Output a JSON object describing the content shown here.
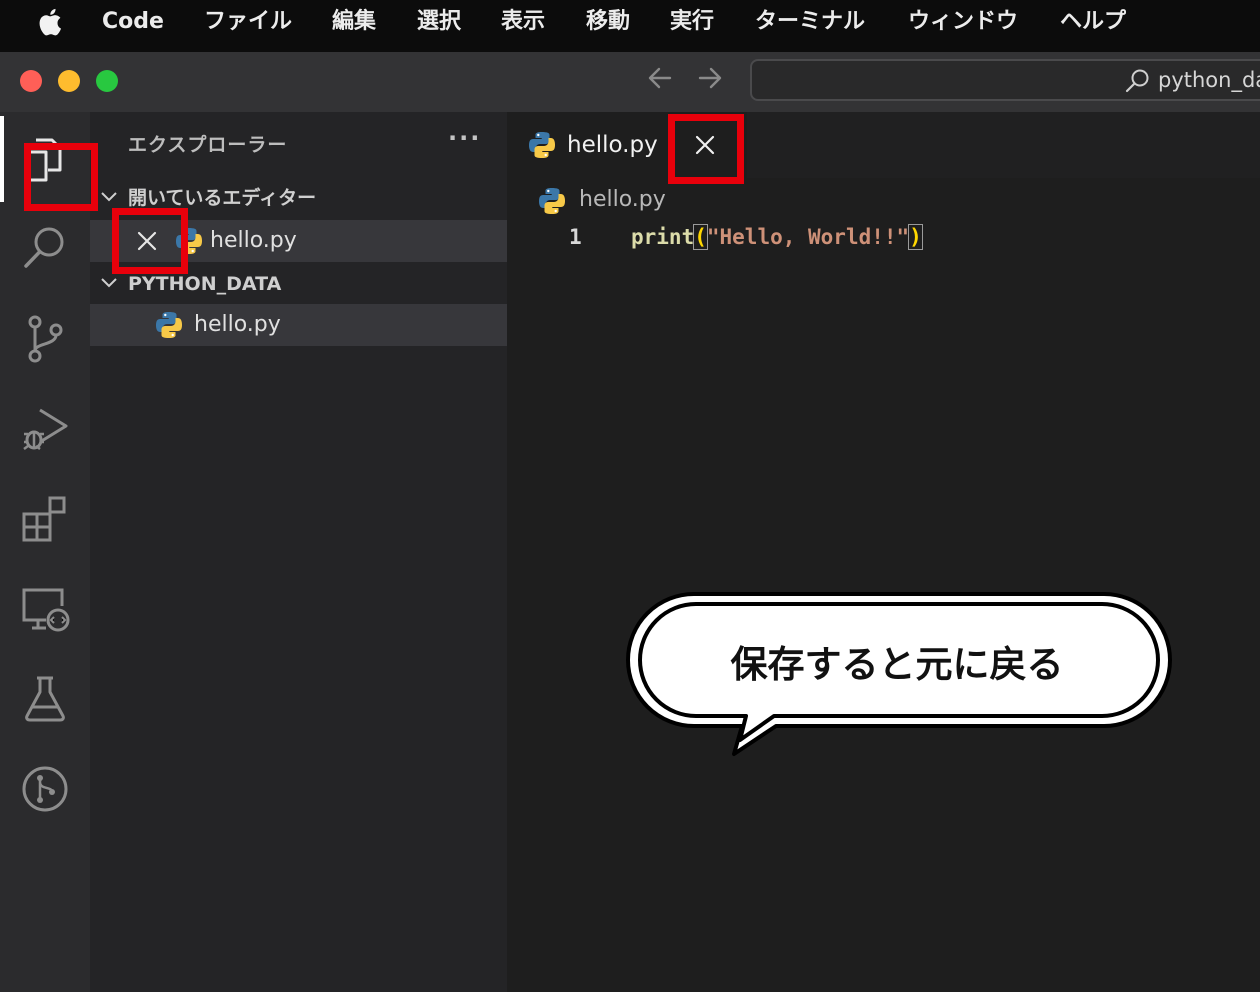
{
  "menubar": {
    "app_name": "Code",
    "items": [
      "ファイル",
      "編集",
      "選択",
      "表示",
      "移動",
      "実行",
      "ターミナル",
      "ウィンドウ",
      "ヘルプ"
    ]
  },
  "titlebar": {
    "search_text": "python_da"
  },
  "activity_bar": {
    "icons": [
      "explorer-icon",
      "search-icon",
      "source-control-icon",
      "run-debug-icon",
      "extensions-icon",
      "remote-explorer-icon",
      "testing-icon",
      "git-graph-icon"
    ]
  },
  "sidebar": {
    "title": "エクスプローラー",
    "more": "···",
    "open_editors": {
      "header": "開いているエディター",
      "files": [
        "hello.py"
      ]
    },
    "folder": {
      "header": "PYTHON_DATA",
      "files": [
        "hello.py"
      ]
    }
  },
  "editor": {
    "tab_name": "hello.py",
    "breadcrumb": "hello.py",
    "line_number": "1",
    "code": {
      "fn": "print",
      "open": "(",
      "str": "\"Hello, World!!\"",
      "close": ")"
    }
  },
  "annotation": {
    "bubble_text": "保存すると元に戻る"
  },
  "colors": {
    "highlight": "#e8000b",
    "traffic_red": "#ff5f57",
    "traffic_yellow": "#febc2e",
    "traffic_green": "#28c840",
    "python_blue": "#3b77a8",
    "python_yellow": "#f7c948"
  }
}
